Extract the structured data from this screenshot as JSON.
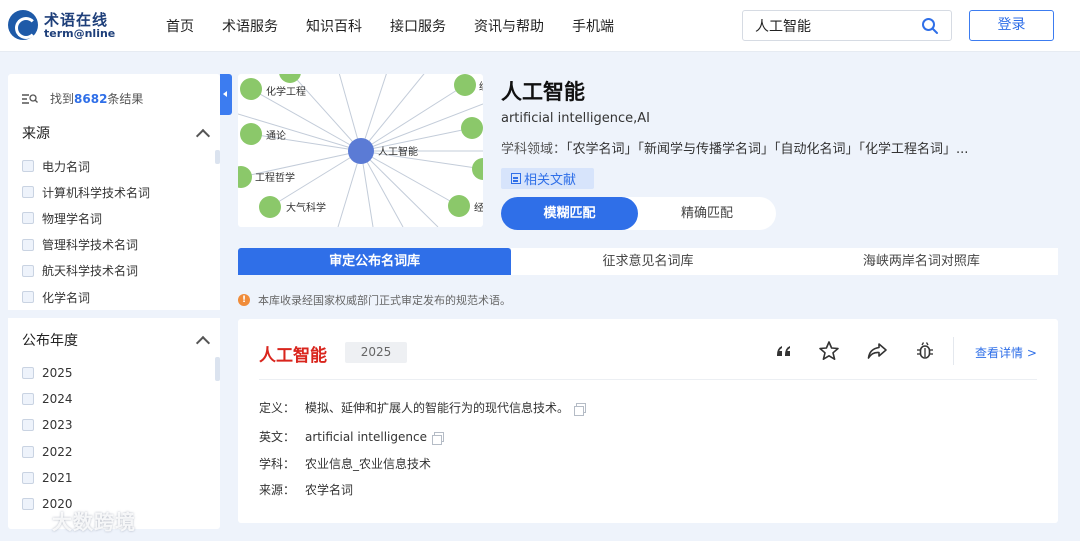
{
  "header": {
    "logo_cn": "术语在线",
    "logo_en": "term@nline",
    "nav": [
      "首页",
      "术语服务",
      "知识百科",
      "接口服务",
      "资讯与帮助",
      "手机端"
    ],
    "search_value": "人工智能",
    "login_label": "登录"
  },
  "sidebar": {
    "result_prefix": "找到",
    "result_count": "8682",
    "result_suffix": "条结果",
    "source": {
      "title": "来源",
      "items": [
        "电力名词",
        "计算机科学技术名词",
        "物理学名词",
        "管理科学技术名词",
        "航天科学技术名词",
        "化学名词"
      ]
    },
    "year": {
      "title": "公布年度",
      "items": [
        "2025",
        "2024",
        "2023",
        "2022",
        "2021",
        "2020"
      ]
    }
  },
  "graph": {
    "center": "人工智能",
    "labels": [
      "化学工程",
      "通论",
      "工程哲学",
      "大气科学",
      "纺织",
      "经"
    ]
  },
  "term": {
    "title": "人工智能",
    "english": "artificial intelligence,AI",
    "domains_label": "学科领域：",
    "domains": "「农学名词」「新闻学与传播学名词」「自动化名词」「化学工程名词」...",
    "literature_label": "相关文献",
    "match_fuzzy": "模糊匹配",
    "match_exact": "精确匹配"
  },
  "library_tabs": [
    "审定公布名词库",
    "征求意见名词库",
    "海峡两岸名词对照库"
  ],
  "notice": "本库收录经国家权威部门正式审定发布的规范术语。",
  "result": {
    "title": "人工智能",
    "year": "2025",
    "details_label": "查看详情 >",
    "fields": [
      {
        "key": "定义：",
        "value": "模拟、延伸和扩展人的智能行为的现代信息技术。"
      },
      {
        "key": "英文：",
        "value": "artificial intelligence"
      },
      {
        "key": "学科：",
        "value": "农业信息_农业信息技术"
      },
      {
        "key": "来源：",
        "value": "农学名词"
      }
    ]
  },
  "watermark": "大数跨境",
  "colors": {
    "accent": "#2f6fe8",
    "title_red": "#d9251d",
    "node_green": "#8bc86a",
    "node_center": "#5b7bd5"
  }
}
